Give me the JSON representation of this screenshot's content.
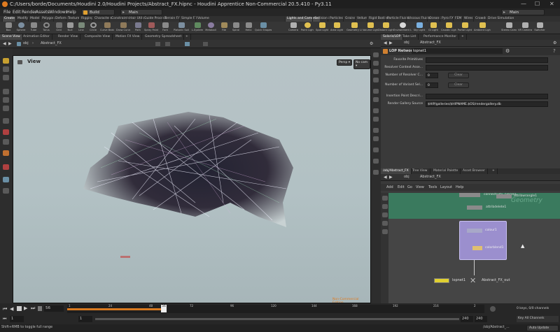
{
  "window": {
    "title": "C:/Users/borde/Documents/Houdini 2.0/Houdini Projects/Abstract_FX.hipnc - Houdini Apprentice Non-Commercial 20.5.410 - Py3.11",
    "minimize": "—",
    "maximize": "☐",
    "close": "✕"
  },
  "menu": {
    "items": [
      "File",
      "Edit",
      "Render",
      "Assets",
      "Windows",
      "Help"
    ],
    "build_label": "Build",
    "desktop_label": "Main",
    "desktop2_label": "Main"
  },
  "shelf_tabs_left": [
    "Create",
    "Modify",
    "Model",
    "Polygon",
    "Deform",
    "Texture",
    "Rigging",
    "Characters",
    "Constraints",
    "Hair Utils",
    "Guide Process",
    "Terrain FX",
    "Simple FX",
    "Volume"
  ],
  "shelf_tabs_right": [
    "Lights and Cameras",
    "Collisions",
    "Particles",
    "Grains",
    "Vellum",
    "Rigid Bodies",
    "Particle Fluids",
    "Viscous Fluids",
    "Oceans",
    "Pyro FX",
    "FEM",
    "Wires",
    "Crowds",
    "Drive Simulation"
  ],
  "shelf_tools_left": [
    "Box",
    "Sphere",
    "Tube",
    "Torus",
    "Grid",
    "Null",
    "Line",
    "Circle",
    "Curve Bezier",
    "Draw Curve",
    "Path",
    "Spray Paint",
    "Font",
    "Platonic Solids",
    "L-System",
    "Metaball",
    "File",
    "Spiral",
    "Helix",
    "Quick Shapes"
  ],
  "shelf_tools_right": [
    "Camera",
    "Point Light",
    "Spot Light",
    "Area Light",
    "Geometry Light",
    "Volume Light",
    "Distant Light",
    "Environment Light",
    "Sky Light",
    "GI Light",
    "Caustic Light",
    "Portal Light",
    "Ambient Light",
    "Stereo Camera",
    "VR Camera",
    "Switcher"
  ],
  "left_pane_tabs": [
    "Scene View",
    "Animation Editor",
    "Render View",
    "Composite View",
    "Motion FX View",
    "Geometry Spreadsheet"
  ],
  "right_pane_tabs": [
    "Solaris/LOP",
    "Take List",
    "Performance Monitor"
  ],
  "left_path": {
    "context": "obj",
    "node": "Abstract_FX"
  },
  "right_path": {
    "context": "obj",
    "node": "Abstract_FX"
  },
  "viewport": {
    "title": "View",
    "persp": "Persp ▾",
    "cam": "No cam ▾",
    "watermark": "Non-Commercial Edition"
  },
  "params": {
    "header_type": "LOP Network",
    "node_name": "lopnet1",
    "rows": [
      {
        "label": "Favorite Primitives",
        "value": ""
      },
      {
        "label": "Resolver Context Asse...",
        "value": ""
      },
      {
        "label": "Number of Resolver C...",
        "value": "0"
      },
      {
        "label": "Number of Variant Sel...",
        "value": "0"
      },
      {
        "label": "Insertion Point Descri...",
        "value": ""
      },
      {
        "label": "Render Gallery Source",
        "value": "$HIP/galleries/$HIPNAME.$OS/rendergallery.db"
      }
    ],
    "clear_label": "Clear"
  },
  "network_tabs": [
    "/obj/Abstract_FX",
    "Tree View",
    "Material Palette",
    "Asset Browser"
  ],
  "network_path": {
    "context": "obj",
    "node": "Abstract_FX"
  },
  "network_menu": [
    "Add",
    "Edit",
    "Go",
    "View",
    "Tools",
    "Layout",
    "Help"
  ],
  "network": {
    "geometry_watermark": "Geometry",
    "node_labels": [
      "connectivity_pieces1",
      "attribwrangle1",
      "attribdelete1",
      "colour1",
      "colorblend1",
      "lopnet1",
      "Abstract_FX_out"
    ]
  },
  "timeline": {
    "frame": "56",
    "start": "1",
    "start2": "1",
    "end": "240",
    "end2": "240",
    "ticks": [
      "1",
      "24",
      "48",
      "72",
      "96",
      "120",
      "144",
      "168",
      "192",
      "216",
      "2"
    ],
    "keys": "0 keys, 0/0 channels",
    "key_all": "Key All Channels",
    "status": "Shift+RMB to toggle full range",
    "path": "/obj/Abstract_...",
    "auto_update": "Auto Update"
  }
}
